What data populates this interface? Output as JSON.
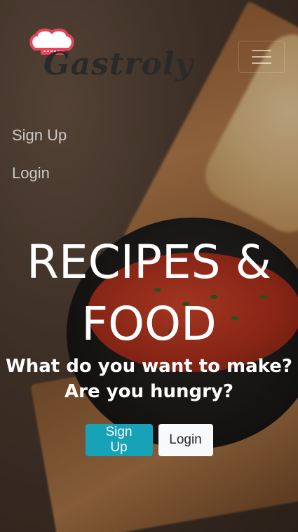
{
  "brand": {
    "name": "Gastroly",
    "hat_color": "#e5445a"
  },
  "nav": {
    "toggle_icon": "hamburger-icon",
    "links": [
      {
        "label": "Sign Up"
      },
      {
        "label": "Login"
      }
    ]
  },
  "hero": {
    "title_line1": "RECIPES &",
    "title_line2": "FOOD",
    "subtitle_line1": "What do you want to make?",
    "subtitle_line2": "Are you hungry?",
    "primary_button": "Sign Up",
    "secondary_button": "Login",
    "primary_color": "#17a2b8"
  }
}
